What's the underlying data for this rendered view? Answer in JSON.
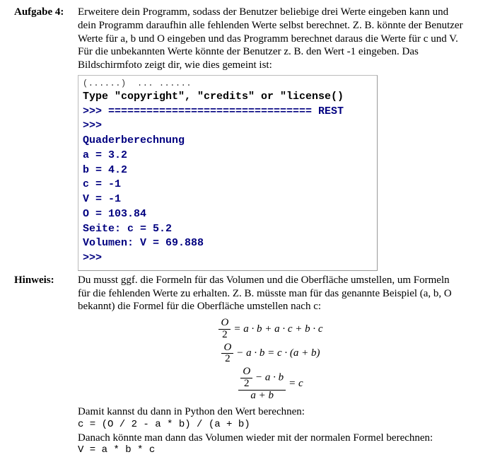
{
  "task": {
    "label": "Aufgabe 4:",
    "text": "Erweitere dein Programm, sodass der Benutzer beliebige drei Werte eingeben kann und dein Programm daraufhin alle fehlenden Werte selbst berechnet. Z. B. könnte der Benutzer Werte für a, b und O eingeben und das Programm berechnet daraus die Werte für c und V. Für die unbekannten Werte könnte der Benutzer z. B. den Wert -1 eingeben. Das Bildschirmfoto zeigt dir, wie dies gemeint ist:"
  },
  "terminal": {
    "top_clip": "(......)  ... ......",
    "line1": "Type \"copyright\", \"credits\" or \"license()",
    "line2": ">>> ================================ REST",
    "line3": ">>> ",
    "line4": "Quaderberechnung",
    "line5": "a = 3.2",
    "line6": "b = 4.2",
    "line7": "c = -1",
    "line8": "V = -1",
    "line9": "O = 103.84",
    "line10": "Seite: c = 5.2",
    "line11": "Volumen: V = 69.888",
    "line12": ">>> "
  },
  "hint": {
    "label": "Hinweis:",
    "text1": "Du musst ggf. die Formeln für das Volumen und die Oberfläche umstellen, um Formeln für die fehlenden Werte zu erhalten. Z. B. müsste man für das genannte Beispiel (a, b, O bekannt) die Formel für die Oberfläche umstellen nach c:",
    "eq1_frac_num": "O",
    "eq1_frac_den": "2",
    "eq1_rhs": " = a · b + a · c + b · c",
    "eq2_frac_num": "O",
    "eq2_frac_den": "2",
    "eq2_mid": " − a · b = c · (a + b)",
    "eq3_big_num_pre": " − a · b",
    "eq3_big_den": "a + b",
    "eq3_rhs": " = c",
    "text2": "Damit kannst du dann in Python den Wert berechnen:",
    "code1": "c = (O / 2 - a * b) / (a + b)",
    "text3": "Danach könnte man dann das Volumen wieder mit der normalen Formel berechnen:",
    "code2": "V = a * b * c"
  }
}
